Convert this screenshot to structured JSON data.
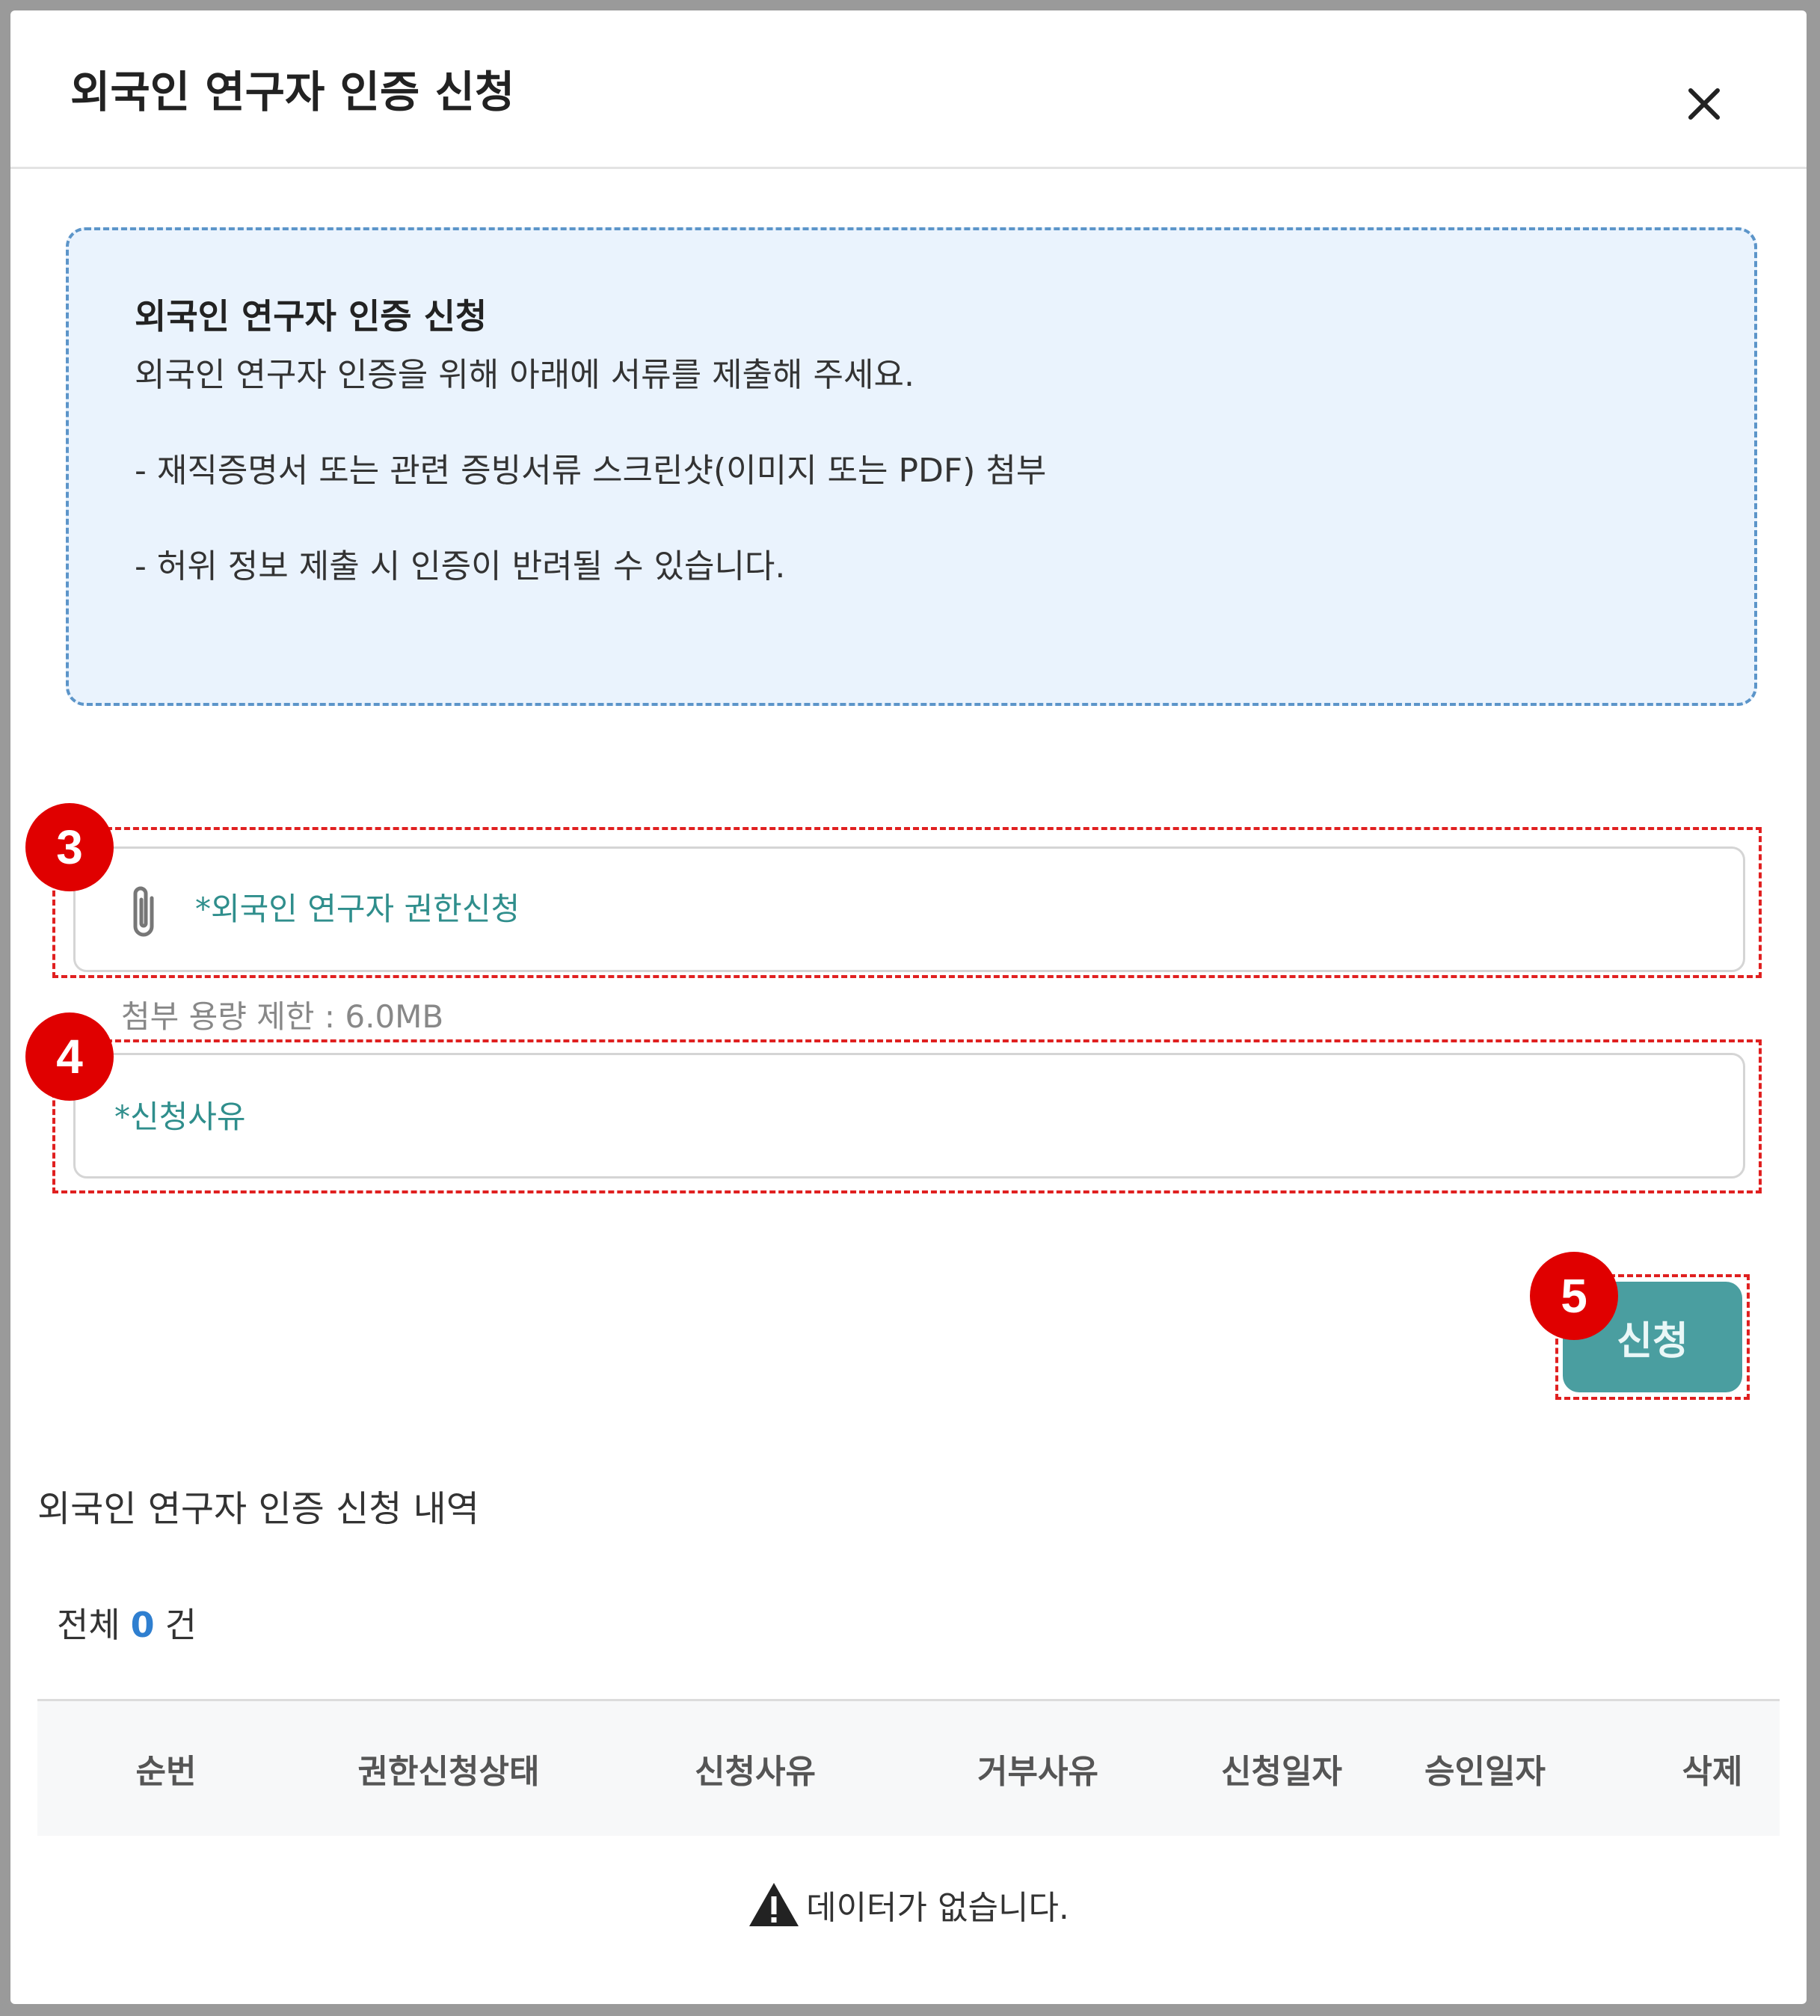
{
  "modal": {
    "title": "외국인 연구자 인증 신청",
    "close_icon": "close-icon"
  },
  "notice": {
    "title": "외국인 연구자 인증 신청",
    "lines": [
      "외국인 연구자 인증을 위해 아래에 서류를 제출해 주세요.",
      "- 재직증명서 또는 관련 증빙서류 스크린샷(이미지 또는 PDF) 첨부",
      "- 허위 정보 제출 시 인증이 반려될 수 있습니다."
    ]
  },
  "markers": [
    "3",
    "4",
    "5"
  ],
  "attachment": {
    "icon": "paperclip-icon",
    "placeholder": "*외국인 연구자 권한신청",
    "limit_text": "첨부 용량 제한 : 6.0MB"
  },
  "reason": {
    "placeholder": "*신청사유"
  },
  "submit": {
    "label": "신청"
  },
  "history": {
    "title": "외국인 연구자 인증 신청 내역",
    "total_prefix": "전체",
    "total_count": "0",
    "total_suffix": "건",
    "columns": [
      "순번",
      "권한신청상태",
      "신청사유",
      "거부사유",
      "신청일자",
      "승인일자",
      "삭제"
    ],
    "empty_icon": "warning-icon",
    "empty_text": "데이터가 없습니다."
  },
  "colors": {
    "accent": "#4a9ea0",
    "notice_bg": "#eaf3fd",
    "marker": "#e00000",
    "count": "#2f7fd0"
  }
}
